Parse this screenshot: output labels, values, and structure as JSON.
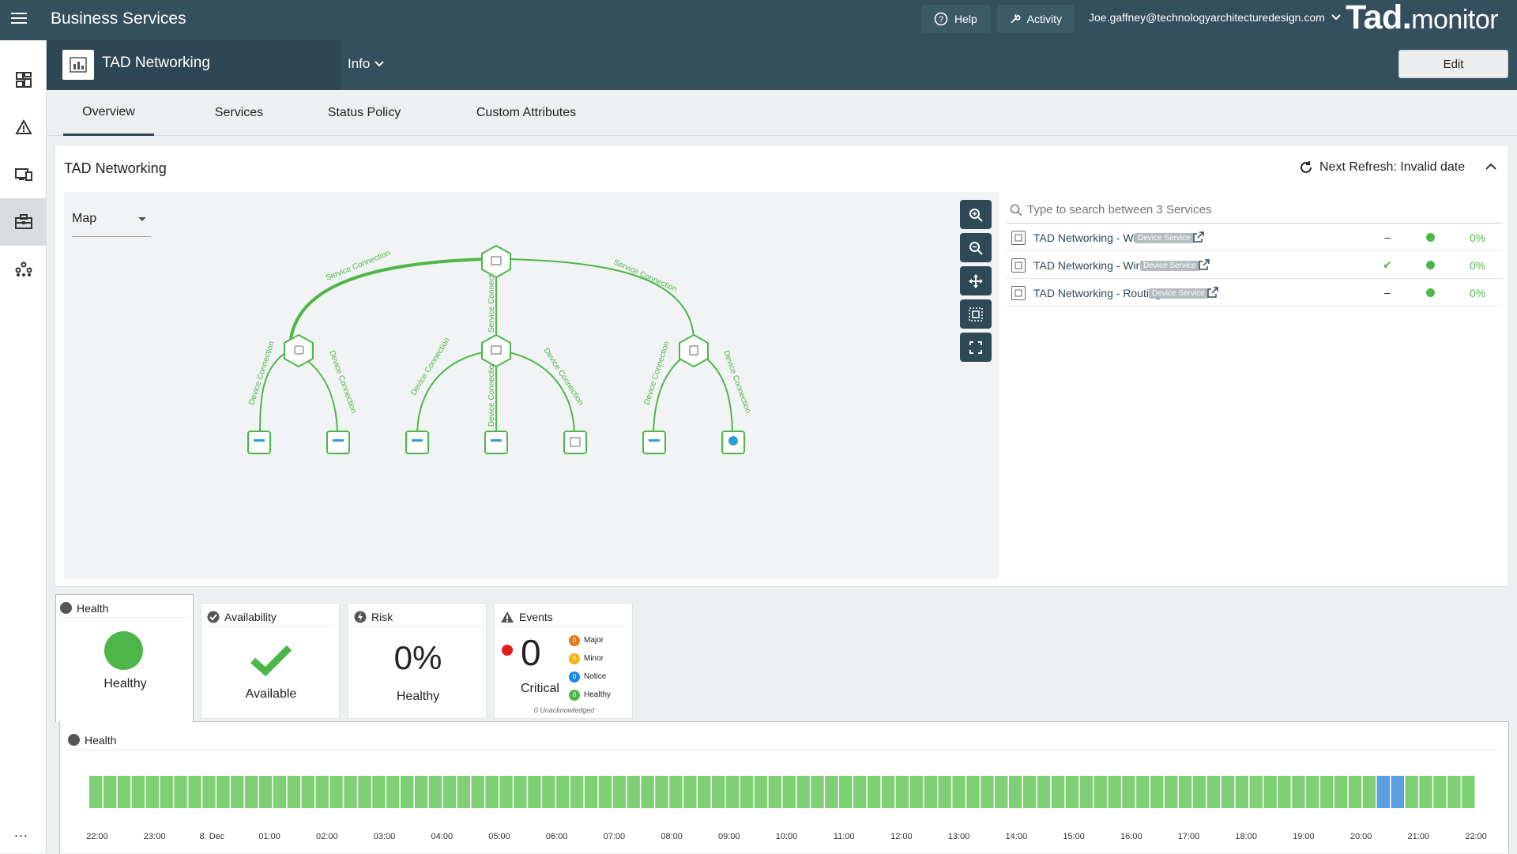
{
  "app": {
    "title": "Business Services",
    "brand_bold": "Tad.",
    "brand_rest": "monitor"
  },
  "topbar": {
    "help": "Help",
    "activity": "Activity",
    "user": "Joe.gaffney@technologyarchitecturedesign.com"
  },
  "sidebar": {
    "items": [
      "dashboard-icon",
      "alert-icon",
      "devices-icon",
      "business-services-icon",
      "topology-icon"
    ],
    "active": "business-services-icon",
    "more": "..."
  },
  "subheader": {
    "title": "TAD Networking",
    "info": "Info",
    "edit": "Edit"
  },
  "tabs": [
    "Overview",
    "Services",
    "Status Policy",
    "Custom Attributes"
  ],
  "card": {
    "title": "TAD Networking",
    "refresh": "Next Refresh: Invalid date"
  },
  "map": {
    "view_select": "Map",
    "service_connection": "Service Connection",
    "device_connection": "Device Connection"
  },
  "services": {
    "search_placeholder": "Type to search between 3 Services",
    "rows": [
      {
        "name": "TAD Networking - Wi-Fi",
        "badge": "Device Service",
        "availability": "–",
        "availability_ok": false,
        "status_color": "#4cb748",
        "risk": "0%"
      },
      {
        "name": "TAD Networking - Wired",
        "badge": "Device Service",
        "availability": "✔",
        "availability_ok": true,
        "status_color": "#4cb748",
        "risk": "0%"
      },
      {
        "name": "TAD Networking - Routing",
        "badge": "Device Service",
        "availability": "–",
        "availability_ok": false,
        "status_color": "#4cb748",
        "risk": "0%"
      }
    ]
  },
  "widgets": {
    "health": {
      "title": "Health",
      "value": "Healthy",
      "color": "#4cb748"
    },
    "availability": {
      "title": "Availability",
      "value": "Available"
    },
    "risk": {
      "title": "Risk",
      "value": "0%",
      "label": "Healthy"
    },
    "events": {
      "title": "Events",
      "count": "0",
      "label": "Critical",
      "unack": "0 Unacknowledged",
      "breakdown": [
        {
          "label": "Major",
          "count": "0",
          "color": "#e8791a"
        },
        {
          "label": "Minor",
          "count": "0",
          "color": "#f2b416"
        },
        {
          "label": "Notice",
          "count": "0",
          "color": "#1e88e5"
        },
        {
          "label": "Healthy",
          "count": "0",
          "color": "#4cb748"
        }
      ]
    }
  },
  "timeline": {
    "title": "Health",
    "labels": [
      "22:00",
      "23:00",
      "8. Dec",
      "01:00",
      "02:00",
      "03:00",
      "04:00",
      "05:00",
      "06:00",
      "07:00",
      "08:00",
      "09:00",
      "10:00",
      "11:00",
      "12:00",
      "13:00",
      "14:00",
      "15:00",
      "16:00",
      "17:00",
      "18:00",
      "19:00",
      "20:00",
      "21:00",
      "22:00"
    ],
    "bar_count": 98,
    "blue_bars": [
      91,
      92
    ],
    "colors": {
      "healthy": "#7fcf75",
      "other": "#5a9fe0"
    }
  }
}
